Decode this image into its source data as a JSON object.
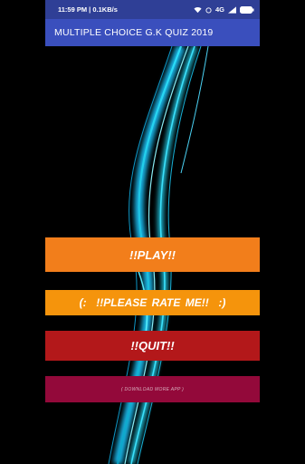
{
  "status_bar": {
    "time_speed": "11:59 PM | 0.1KB/s",
    "network": "4G",
    "icons": [
      "wifi-icon",
      "signal-icon",
      "battery-icon"
    ]
  },
  "app_bar": {
    "title": "MULTIPLE CHOICE G.K QUIZ 2019"
  },
  "buttons": {
    "play": "!!PLAY!!",
    "rate": "(:  !!PLEASE RATE ME!!  :)",
    "quit": "!!QUIT!!",
    "download": "( DOWNLOAD MORE APP )"
  },
  "colors": {
    "status_bar": "#2f3f96",
    "app_bar": "#3a4fbd",
    "play": "#f27e1b",
    "rate": "#f5940c",
    "quit": "#b3181a",
    "download": "#93093a",
    "background_glow": "#2fe8ff"
  }
}
